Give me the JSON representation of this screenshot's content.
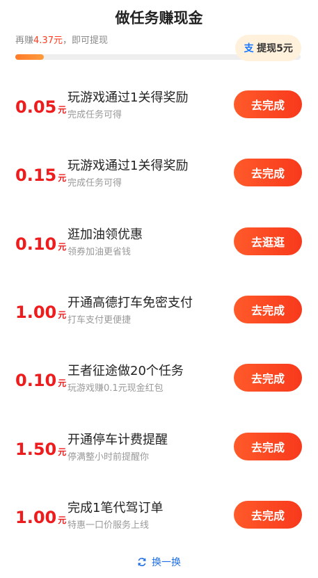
{
  "header": {
    "title": "做任务赚现金"
  },
  "progress": {
    "prefix": "再赚",
    "amount": "4.37元",
    "suffix": "，即可提现",
    "fraction": 0.1
  },
  "withdraw": {
    "icon": "alipay-icon",
    "label": "提现5元"
  },
  "tasks": [
    {
      "amount": "0.05",
      "unit": "元",
      "title": "玩游戏通过1关得奖励",
      "subtitle": "完成任务可得",
      "button": "去完成"
    },
    {
      "amount": "0.15",
      "unit": "元",
      "title": "玩游戏通过1关得奖励",
      "subtitle": "完成任务可得",
      "button": "去完成"
    },
    {
      "amount": "0.10",
      "unit": "元",
      "title": "逛加油领优惠",
      "subtitle": "领券加油更省钱",
      "button": "去逛逛"
    },
    {
      "amount": "1.00",
      "unit": "元",
      "title": "开通高德打车免密支付",
      "subtitle": "打车支付更便捷",
      "button": "去完成"
    },
    {
      "amount": "0.10",
      "unit": "元",
      "title": "王者征途做20个任务",
      "subtitle": "玩游戏赚0.1元现金红包",
      "button": "去完成"
    },
    {
      "amount": "1.50",
      "unit": "元",
      "title": "开通停车计费提醒",
      "subtitle": "停满整小时前提醒你",
      "button": "去完成"
    },
    {
      "amount": "1.00",
      "unit": "元",
      "title": "完成1笔代驾订单",
      "subtitle": "特惠一口价服务上线",
      "button": "去完成"
    }
  ],
  "footer": {
    "refresh_label": "换一换",
    "refresh_icon": "refresh-icon"
  },
  "colors": {
    "accent": "#ff3b1f",
    "reward": "#ee1c1c",
    "link": "#1e6ee6"
  }
}
